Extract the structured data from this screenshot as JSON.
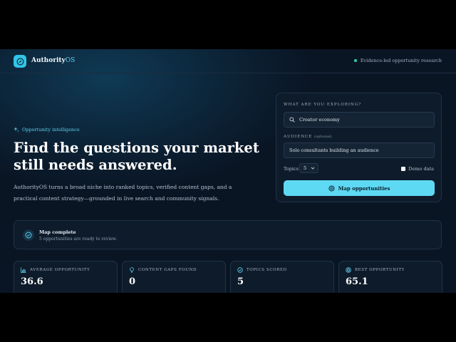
{
  "header": {
    "brand_main": "Authority",
    "brand_accent": "OS",
    "tagline": "Evidence-led opportunity research"
  },
  "hero": {
    "kicker": "Opportunity intelligence",
    "headline": "Find the questions your market still needs answered.",
    "description": "AuthorityOS turns a broad niche into ranked topics, verified content gaps, and a practical content strategy—grounded in live search and community signals."
  },
  "explore": {
    "label": "WHAT ARE YOU EXPLORING?",
    "query_value": "Creator economy",
    "audience_label": "AUDIENCE",
    "audience_optional": "(optional)",
    "audience_value": "Solo consultants building an audience",
    "topics_label": "Topics",
    "topics_value": "5",
    "demo_label": "Demo data",
    "demo_checked": true,
    "button_label": "Map opportunities"
  },
  "status": {
    "title": "Map complete",
    "subtitle": "5 opportunities are ready to review."
  },
  "stats": [
    {
      "label": "AVERAGE OPPORTUNITY",
      "value": "36.6",
      "icon": "bar-chart-icon"
    },
    {
      "label": "CONTENT GAPS FOUND",
      "value": "0",
      "icon": "lightbulb-icon"
    },
    {
      "label": "TOPICS SCORED",
      "value": "5",
      "icon": "check-circle-icon"
    },
    {
      "label": "BEST OPPORTUNITY",
      "value": "65.1",
      "icon": "target-icon"
    }
  ],
  "colors": {
    "accent": "#5ed9f4",
    "background": "#0a1524",
    "status_dot": "#2fd3a5"
  }
}
